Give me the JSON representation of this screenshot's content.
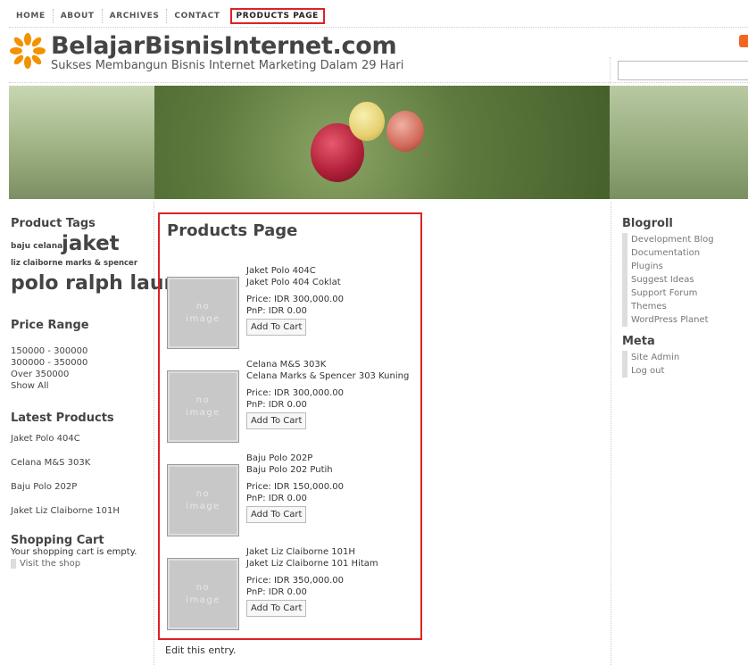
{
  "nav": {
    "items": [
      "HOME",
      "ABOUT",
      "ARCHIVES",
      "CONTACT"
    ],
    "active": "PRODUCTS PAGE"
  },
  "site": {
    "title": "BelajarBisnisInternet.com",
    "tagline": "Sukses Membangun Bisnis Internet Marketing Dalam 29 Hari"
  },
  "left_sidebar": {
    "tags_title": "Product Tags",
    "tags": [
      "baju celana",
      "jaket",
      "liz claiborne marks & spencer",
      "polo ralph lauren"
    ],
    "price_title": "Price Range",
    "price_ranges": [
      "150000 - 300000",
      "300000 - 350000",
      "Over 350000",
      "Show All"
    ],
    "latest_title": "Latest Products",
    "latest": [
      "Jaket Polo 404C",
      "Celana M&S 303K",
      "Baju Polo 202P",
      "Jaket Liz Claiborne 101H"
    ],
    "cart_title": "Shopping Cart",
    "cart_empty": "Your shopping cart is empty.",
    "cart_link": "Visit the shop"
  },
  "main": {
    "title": "Products Page",
    "no_image": [
      "no",
      "image"
    ],
    "products": [
      {
        "code": "Jaket Polo 404C",
        "name": "Jaket Polo 404 Coklat",
        "price": "Price: IDR 300,000.00",
        "pnp": "PnP: IDR 0.00",
        "button": "Add To Cart"
      },
      {
        "code": "Celana M&S 303K",
        "name": "Celana Marks & Spencer 303 Kuning",
        "price": "Price: IDR 300,000.00",
        "pnp": "PnP: IDR 0.00",
        "button": "Add To Cart"
      },
      {
        "code": "Baju Polo 202P",
        "name": "Baju Polo 202 Putih",
        "price": "Price: IDR 150,000.00",
        "pnp": "PnP: IDR 0.00",
        "button": "Add To Cart"
      },
      {
        "code": "Jaket Liz Claiborne 101H",
        "name": "Jaket Liz Claiborne 101 Hitam",
        "price": "Price: IDR 350,000.00",
        "pnp": "PnP: IDR 0.00",
        "button": "Add To Cart"
      }
    ],
    "edit_link": "Edit this entry."
  },
  "right_sidebar": {
    "blogroll_title": "Blogroll",
    "blogroll": [
      "Development Blog",
      "Documentation",
      "Plugins",
      "Suggest Ideas",
      "Support Forum",
      "Themes",
      "WordPress Planet"
    ],
    "meta_title": "Meta",
    "meta": [
      "Site Admin",
      "Log out"
    ]
  },
  "colors": {
    "highlight": "#dd2222",
    "logo_orange": "#f39200"
  }
}
